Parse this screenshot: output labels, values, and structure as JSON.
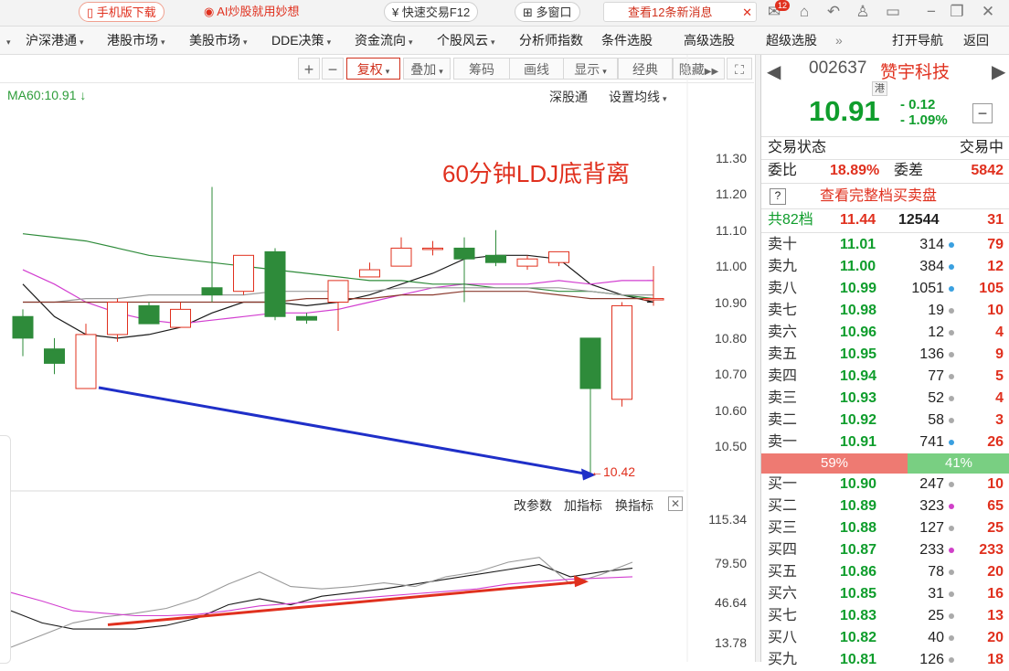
{
  "topbar": {
    "mobile_btn": "手机版下载",
    "ai_btn": "AI炒股就用妙想",
    "trade_btn": "快速交易F12",
    "multiwin_btn": "多窗口",
    "msg_btn": "查看12条新消息",
    "msg_close": "✕",
    "msg_badge": "12"
  },
  "menu": [
    {
      "label": "沪深港通",
      "caret": true
    },
    {
      "label": "港股市场",
      "caret": true
    },
    {
      "label": "美股市场",
      "caret": true
    },
    {
      "label": "DDE决策",
      "caret": true
    },
    {
      "label": "资金流向",
      "caret": true
    },
    {
      "label": "个股风云",
      "caret": true
    },
    {
      "label": "分析师指数",
      "caret": false
    },
    {
      "label": "条件选股",
      "caret": false
    },
    {
      "label": "高级选股",
      "caret": false
    },
    {
      "label": "超级选股",
      "caret": false
    },
    {
      "label": "»",
      "caret": false
    },
    {
      "label": "打开导航",
      "caret": false
    },
    {
      "label": "返回",
      "caret": false
    }
  ],
  "chart_toolbar": {
    "plus": "+",
    "minus": "−",
    "fuquan": "复权",
    "diejia": "叠加",
    "chouma": "筹码",
    "huaxian": "画线",
    "xianshi": "显示",
    "jingdian": "经典",
    "yincang": "隐藏",
    "expand": "⛶"
  },
  "main_chart": {
    "ma_legend": "MA60:10.91 ↓",
    "link_market": "深股通",
    "link_ma": "设置均线",
    "annotation": "60分钟LDJ底背离",
    "low_label": "←10.42"
  },
  "sub_chart": {
    "link_param": "改参数",
    "link_add": "加指标",
    "link_swap": "换指标",
    "close": "✕"
  },
  "quote": {
    "code": "002637",
    "name": "赞宇科技",
    "hk_tag": "港",
    "price": "10.91",
    "change": "- 0.12",
    "change_pct": "- 1.09%",
    "status_label": "交易状态",
    "status_value": "交易中",
    "weibi_label": "委比",
    "weibi_value": "18.89%",
    "weicha_label": "委差",
    "weicha_value": "5842",
    "help": "?",
    "full_book": "查看完整档买卖盘",
    "summary_label": "共82档",
    "summary_price": "11.44",
    "summary_vol": "12544",
    "summary_cnt": "31",
    "sell_pct": "59%",
    "buy_pct": "41%",
    "sell_ratio": 0.59,
    "asks": [
      {
        "label": "卖十",
        "price": "11.01",
        "vol": "314",
        "cnt": "79",
        "dot": "#3aa0e0"
      },
      {
        "label": "卖九",
        "price": "11.00",
        "vol": "384",
        "cnt": "12",
        "dot": "#3aa0e0"
      },
      {
        "label": "卖八",
        "price": "10.99",
        "vol": "1051",
        "cnt": "105",
        "dot": "#3aa0e0"
      },
      {
        "label": "卖七",
        "price": "10.98",
        "vol": "19",
        "cnt": "10",
        "dot": "#aaaaaa"
      },
      {
        "label": "卖六",
        "price": "10.96",
        "vol": "12",
        "cnt": "4",
        "dot": "#aaaaaa"
      },
      {
        "label": "卖五",
        "price": "10.95",
        "vol": "136",
        "cnt": "9",
        "dot": "#aaaaaa"
      },
      {
        "label": "卖四",
        "price": "10.94",
        "vol": "77",
        "cnt": "5",
        "dot": "#aaaaaa"
      },
      {
        "label": "卖三",
        "price": "10.93",
        "vol": "52",
        "cnt": "4",
        "dot": "#aaaaaa"
      },
      {
        "label": "卖二",
        "price": "10.92",
        "vol": "58",
        "cnt": "3",
        "dot": "#aaaaaa"
      },
      {
        "label": "卖一",
        "price": "10.91",
        "vol": "741",
        "cnt": "26",
        "dot": "#3aa0e0"
      }
    ],
    "bids": [
      {
        "label": "买一",
        "price": "10.90",
        "vol": "247",
        "cnt": "10",
        "dot": "#aaaaaa"
      },
      {
        "label": "买二",
        "price": "10.89",
        "vol": "323",
        "cnt": "65",
        "dot": "#d040c8"
      },
      {
        "label": "买三",
        "price": "10.88",
        "vol": "127",
        "cnt": "25",
        "dot": "#aaaaaa"
      },
      {
        "label": "买四",
        "price": "10.87",
        "vol": "233",
        "cnt": "233",
        "dot": "#d040c8"
      },
      {
        "label": "买五",
        "price": "10.86",
        "vol": "78",
        "cnt": "20",
        "dot": "#aaaaaa"
      },
      {
        "label": "买六",
        "price": "10.85",
        "vol": "31",
        "cnt": "16",
        "dot": "#aaaaaa"
      },
      {
        "label": "买七",
        "price": "10.83",
        "vol": "25",
        "cnt": "13",
        "dot": "#aaaaaa"
      },
      {
        "label": "买八",
        "price": "10.82",
        "vol": "40",
        "cnt": "20",
        "dot": "#aaaaaa"
      },
      {
        "label": "买九",
        "price": "10.81",
        "vol": "126",
        "cnt": "18",
        "dot": "#aaaaaa"
      }
    ]
  },
  "chart_data": [
    {
      "type": "candlestick",
      "title": "60分钟LDJ底背离",
      "ylim": [
        10.4,
        11.38
      ],
      "yticks": [
        "11.30",
        "11.20",
        "11.10",
        "11.00",
        "10.90",
        "10.80",
        "10.70",
        "10.60",
        "10.50"
      ],
      "up_color": "#e0301e",
      "down_color": "#2e8b3a",
      "candles": [
        {
          "o": 10.86,
          "c": 10.8,
          "h": 10.88,
          "l": 10.75
        },
        {
          "o": 10.77,
          "c": 10.73,
          "h": 10.8,
          "l": 10.7
        },
        {
          "o": 10.66,
          "c": 10.81,
          "h": 10.84,
          "l": 10.66
        },
        {
          "o": 10.81,
          "c": 10.9,
          "h": 10.91,
          "l": 10.79
        },
        {
          "o": 10.89,
          "c": 10.84,
          "h": 10.9,
          "l": 10.84
        },
        {
          "o": 10.83,
          "c": 10.88,
          "h": 10.9,
          "l": 10.83
        },
        {
          "o": 10.94,
          "c": 10.92,
          "h": 11.22,
          "l": 10.9
        },
        {
          "o": 10.93,
          "c": 11.03,
          "h": 11.03,
          "l": 10.92
        },
        {
          "o": 11.04,
          "c": 10.86,
          "h": 11.05,
          "l": 10.85
        },
        {
          "o": 10.86,
          "c": 10.85,
          "h": 10.87,
          "l": 10.84
        },
        {
          "o": 10.9,
          "c": 10.96,
          "h": 10.96,
          "l": 10.82
        },
        {
          "o": 10.97,
          "c": 10.99,
          "h": 11.01,
          "l": 10.97
        },
        {
          "o": 11.0,
          "c": 11.05,
          "h": 11.08,
          "l": 11.0
        },
        {
          "o": 11.05,
          "c": 11.05,
          "h": 11.07,
          "l": 11.03
        },
        {
          "o": 11.05,
          "c": 11.02,
          "h": 11.08,
          "l": 10.9
        },
        {
          "o": 11.03,
          "c": 11.01,
          "h": 11.1,
          "l": 11.0
        },
        {
          "o": 11.0,
          "c": 11.02,
          "h": 11.03,
          "l": 10.99
        },
        {
          "o": 11.01,
          "c": 11.04,
          "h": 11.04,
          "l": 11.0
        },
        {
          "o": 10.8,
          "c": 10.66,
          "h": 10.8,
          "l": 10.42
        },
        {
          "o": 10.63,
          "c": 10.89,
          "h": 10.9,
          "l": 10.61
        },
        {
          "o": 10.91,
          "c": 10.91,
          "h": 11.0,
          "l": 10.89
        }
      ],
      "ma_lines": [
        {
          "color": "#1a1a1a",
          "values": [
            10.95,
            10.86,
            10.81,
            10.8,
            10.81,
            10.83,
            10.87,
            10.9,
            10.9,
            10.89,
            10.9,
            10.92,
            10.95,
            10.98,
            11.02,
            11.03,
            11.03,
            11.02,
            10.95,
            10.92,
            10.9
          ]
        },
        {
          "color": "#d23ed0",
          "values": [
            10.99,
            10.95,
            10.9,
            10.87,
            10.85,
            10.84,
            10.85,
            10.86,
            10.87,
            10.87,
            10.88,
            10.9,
            10.92,
            10.94,
            10.95,
            10.95,
            10.95,
            10.96,
            10.95,
            10.96,
            10.96
          ]
        },
        {
          "color": "#2e8b3a",
          "values": [
            11.09,
            11.08,
            11.07,
            11.05,
            11.03,
            11.02,
            11.01,
            11.0,
            10.99,
            10.98,
            10.97,
            10.96,
            10.96,
            10.95,
            10.95,
            10.94,
            10.94,
            10.93,
            10.93,
            10.92,
            10.91
          ]
        },
        {
          "color": "#999999",
          "values": [
            10.9,
            10.9,
            10.91,
            10.91,
            10.92,
            10.92,
            10.92,
            10.92,
            10.93,
            10.93,
            10.93,
            10.93,
            10.94,
            10.94,
            10.94,
            10.94,
            10.94,
            10.94,
            10.93,
            10.92,
            10.92
          ]
        },
        {
          "color": "#8b3a2e",
          "values": [
            10.9,
            10.9,
            10.9,
            10.9,
            10.9,
            10.9,
            10.9,
            10.9,
            10.9,
            10.91,
            10.91,
            10.91,
            10.92,
            10.92,
            10.93,
            10.93,
            10.93,
            10.92,
            10.91,
            10.91,
            10.91
          ]
        }
      ],
      "divergence_line": {
        "color": "#1f2fc8",
        "from": {
          "idx": 2,
          "value": 10.66
        },
        "to": {
          "idx": 18,
          "value": 10.42
        }
      }
    },
    {
      "type": "line",
      "yticks": [
        "115.34",
        "79.50",
        "46.64",
        "13.78"
      ],
      "ylim": [
        5,
        120
      ],
      "series": [
        {
          "color": "#1a1a1a",
          "values": [
            40,
            30,
            25,
            25,
            25,
            28,
            34,
            45,
            50,
            45,
            52,
            55,
            58,
            62,
            66,
            70,
            74,
            78,
            68,
            72,
            75
          ]
        },
        {
          "color": "#999999",
          "values": [
            10,
            20,
            30,
            35,
            38,
            42,
            50,
            62,
            72,
            60,
            58,
            60,
            63,
            60,
            68,
            72,
            80,
            84,
            62,
            70,
            80
          ]
        },
        {
          "color": "#d23ed0",
          "values": [
            55,
            48,
            40,
            38,
            36,
            36,
            37,
            40,
            44,
            46,
            48,
            50,
            52,
            54,
            56,
            58,
            62,
            64,
            66,
            67,
            68
          ]
        }
      ],
      "divergence_line": {
        "color": "#e0301e",
        "from": {
          "idx": 2,
          "value": 30
        },
        "to": {
          "idx": 18,
          "value": 64
        }
      }
    }
  ]
}
